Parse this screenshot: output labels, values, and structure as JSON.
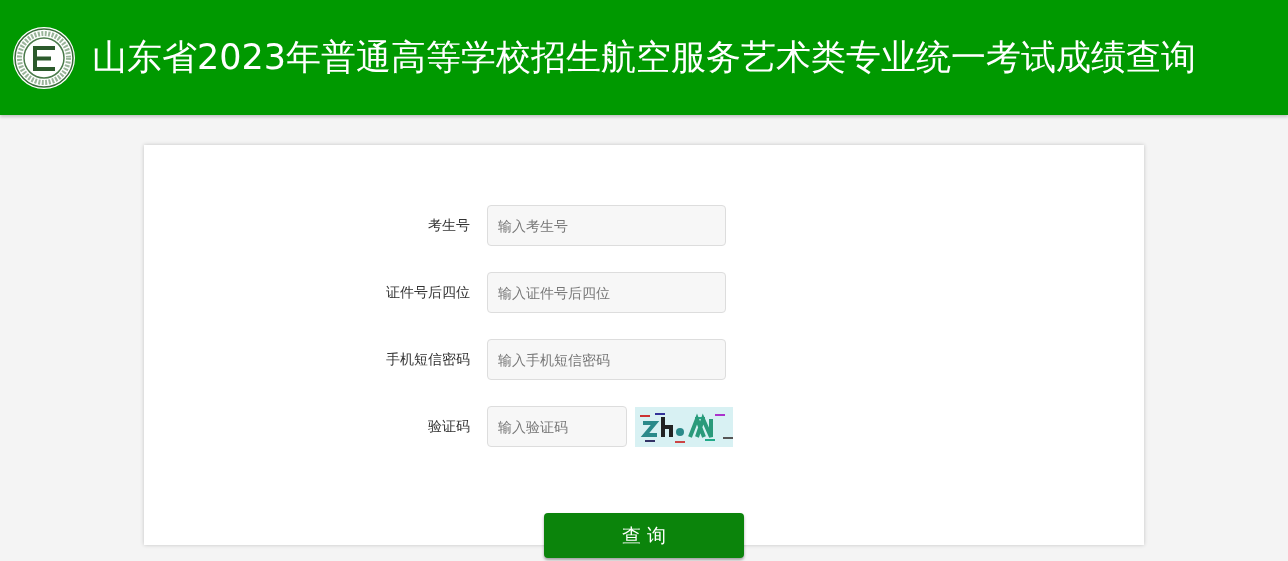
{
  "header": {
    "title": "山东省2023年普通高等学校招生航空服务艺术类专业统一考试成绩查询"
  },
  "form": {
    "fields": [
      {
        "label": "考生号",
        "placeholder": "输入考生号",
        "kind": "text"
      },
      {
        "label": "证件号后四位",
        "placeholder": "输入证件号后四位",
        "kind": "text"
      },
      {
        "label": "手机短信密码",
        "placeholder": "输入手机短信密码",
        "kind": "text"
      },
      {
        "label": "验证码",
        "placeholder": "输入验证码",
        "kind": "captcha"
      }
    ],
    "submit": "查 询"
  }
}
